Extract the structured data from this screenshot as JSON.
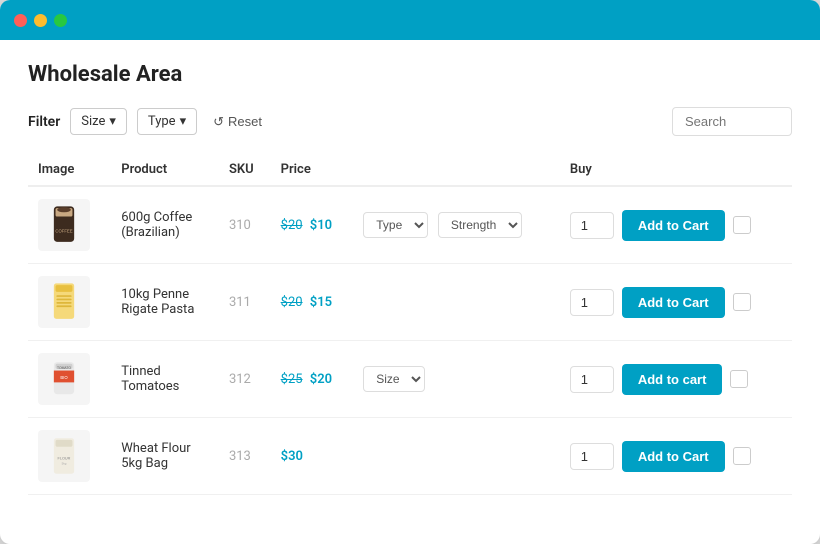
{
  "window": {
    "title": "Wholesale Area"
  },
  "titleBar": {
    "dots": [
      "red",
      "yellow",
      "green"
    ]
  },
  "filterBar": {
    "label": "Filter",
    "sizeDropdown": "Size",
    "typeDropdown": "Type",
    "resetLabel": "Reset",
    "searchPlaceholder": "Search"
  },
  "table": {
    "headers": [
      "Image",
      "Product",
      "SKU",
      "Price",
      "",
      "Buy"
    ],
    "rows": [
      {
        "id": 1,
        "product": "600g Coffee (Brazilian)",
        "sku": "310",
        "priceOriginal": "$20",
        "priceSale": "$10",
        "hasVariant": true,
        "variantLabel": "Type",
        "variantLabel2": "Strength",
        "qty": "1",
        "btnLabel": "Add to Cart"
      },
      {
        "id": 2,
        "product": "10kg Penne Rigate Pasta",
        "sku": "311",
        "priceOriginal": "$20",
        "priceSale": "$15",
        "hasVariant": false,
        "qty": "1",
        "btnLabel": "Add to Cart"
      },
      {
        "id": 3,
        "product": "Tinned Tomatoes",
        "sku": "312",
        "priceOriginal": "$25",
        "priceSale": "$20",
        "hasVariant": true,
        "variantLabel": "Size",
        "qty": "1",
        "btnLabel": "Add to Cart"
      },
      {
        "id": 4,
        "product": "Wheat Flour 5kg Bag",
        "sku": "313",
        "priceOnly": "$30",
        "hasVariant": false,
        "qty": "1",
        "btnLabel": "Add to Cart"
      }
    ]
  },
  "colors": {
    "accent": "#00a0c4",
    "priceColor": "#00a0c4"
  }
}
